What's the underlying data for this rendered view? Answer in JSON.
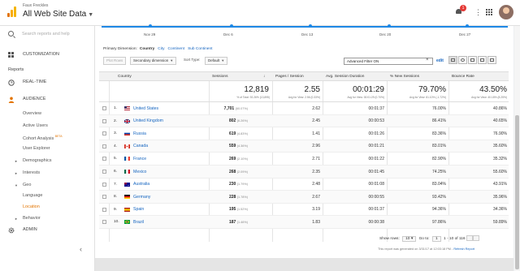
{
  "header": {
    "account": "Faux Freckles",
    "property": "All Web Site Data",
    "notification_count": "1"
  },
  "sidebar": {
    "search_placeholder": "Search reports and help",
    "customization": "CUSTOMIZATION",
    "reports_section": "Reports",
    "realtime": "REAL-TIME",
    "audience": "AUDIENCE",
    "sub_items": [
      "Overview",
      "Active Users",
      "Cohort Analysis",
      "User Explorer",
      "Demographics",
      "Interests",
      "Geo",
      "Language",
      "Location",
      "Behavior"
    ],
    "beta": "BETA",
    "admin": "ADMIN"
  },
  "chart_dates": [
    "Nov 29",
    "Dec 6",
    "Dec 13",
    "Dec 20",
    "Dec 27"
  ],
  "dimensions": {
    "label": "Primary Dimension:",
    "active": "Country",
    "options": [
      "City",
      "Continent",
      "Sub Continent"
    ]
  },
  "controls": {
    "plot_rows": "Plot Rows",
    "secondary_dimension": "Secondary dimension",
    "sort_type_label": "Sort Type:",
    "sort_type_value": "Default",
    "filter_value": "Advanced Filter ON",
    "edit": "edit"
  },
  "table": {
    "headers": [
      "Country",
      "Sessions",
      "Pages / Session",
      "Avg. Session Duration",
      "% New Sessions",
      "Bounce Rate"
    ],
    "totals": [
      {
        "value": "12,819",
        "sub": "% of Total: 92.26% (13,895)"
      },
      {
        "value": "2.55",
        "sub": "Avg for View: 2.56 (0.33%)"
      },
      {
        "value": "00:01:29",
        "sub": "Avg for View: 00:01:29 (0.70%)"
      },
      {
        "value": "79.70%",
        "sub": "Avg for View: 81.10% (-1.72%)"
      },
      {
        "value": "43.50%",
        "sub": "Avg for View: 40.18% (8.25%)"
      }
    ],
    "rows": [
      {
        "idx": "1.",
        "country": "United States",
        "sessions": "7,701",
        "pct": "(60.07%)",
        "pps": "2.62",
        "dur": "00:01:37",
        "new": "76.00%",
        "bounce": "40.86%"
      },
      {
        "idx": "2.",
        "country": "United Kingdom",
        "sessions": "802",
        "pct": "(6.26%)",
        "pps": "2.45",
        "dur": "00:00:53",
        "new": "86.41%",
        "bounce": "40.65%"
      },
      {
        "idx": "3.",
        "country": "Russia",
        "sessions": "619",
        "pct": "(4.83%)",
        "pps": "1.41",
        "dur": "00:01:26",
        "new": "83.36%",
        "bounce": "76.90%"
      },
      {
        "idx": "4.",
        "country": "Canada",
        "sessions": "559",
        "pct": "(4.36%)",
        "pps": "2.96",
        "dur": "00:01:21",
        "new": "83.01%",
        "bounce": "35.60%"
      },
      {
        "idx": "5.",
        "country": "France",
        "sessions": "269",
        "pct": "(2.10%)",
        "pps": "2.71",
        "dur": "00:01:22",
        "new": "82.90%",
        "bounce": "35.32%"
      },
      {
        "idx": "6.",
        "country": "Mexico",
        "sessions": "268",
        "pct": "(2.09%)",
        "pps": "2.35",
        "dur": "00:01:45",
        "new": "74.25%",
        "bounce": "55.60%"
      },
      {
        "idx": "7.",
        "country": "Australia",
        "sessions": "230",
        "pct": "(1.79%)",
        "pps": "2.48",
        "dur": "00:01:08",
        "new": "83.04%",
        "bounce": "43.91%"
      },
      {
        "idx": "8.",
        "country": "Germany",
        "sessions": "228",
        "pct": "(1.78%)",
        "pps": "2.67",
        "dur": "00:00:55",
        "new": "93.42%",
        "bounce": "35.96%"
      },
      {
        "idx": "9.",
        "country": "Spain",
        "sessions": "195",
        "pct": "(1.52%)",
        "pps": "3.19",
        "dur": "00:01:37",
        "new": "94.36%",
        "bounce": "34.36%"
      },
      {
        "idx": "10.",
        "country": "Brazil",
        "sessions": "187",
        "pct": "(1.46%)",
        "pps": "1.83",
        "dur": "00:00:38",
        "new": "97.86%",
        "bounce": "59.89%"
      }
    ]
  },
  "footer": {
    "show_rows": "Show rows:",
    "rows_value": "10",
    "goto": "Go to:",
    "goto_value": "1",
    "range": "1 - 10 of 116",
    "generated": "This report was generated on 3/31/17 at 12:03:18 PM -",
    "refresh": "Refresh Report"
  }
}
